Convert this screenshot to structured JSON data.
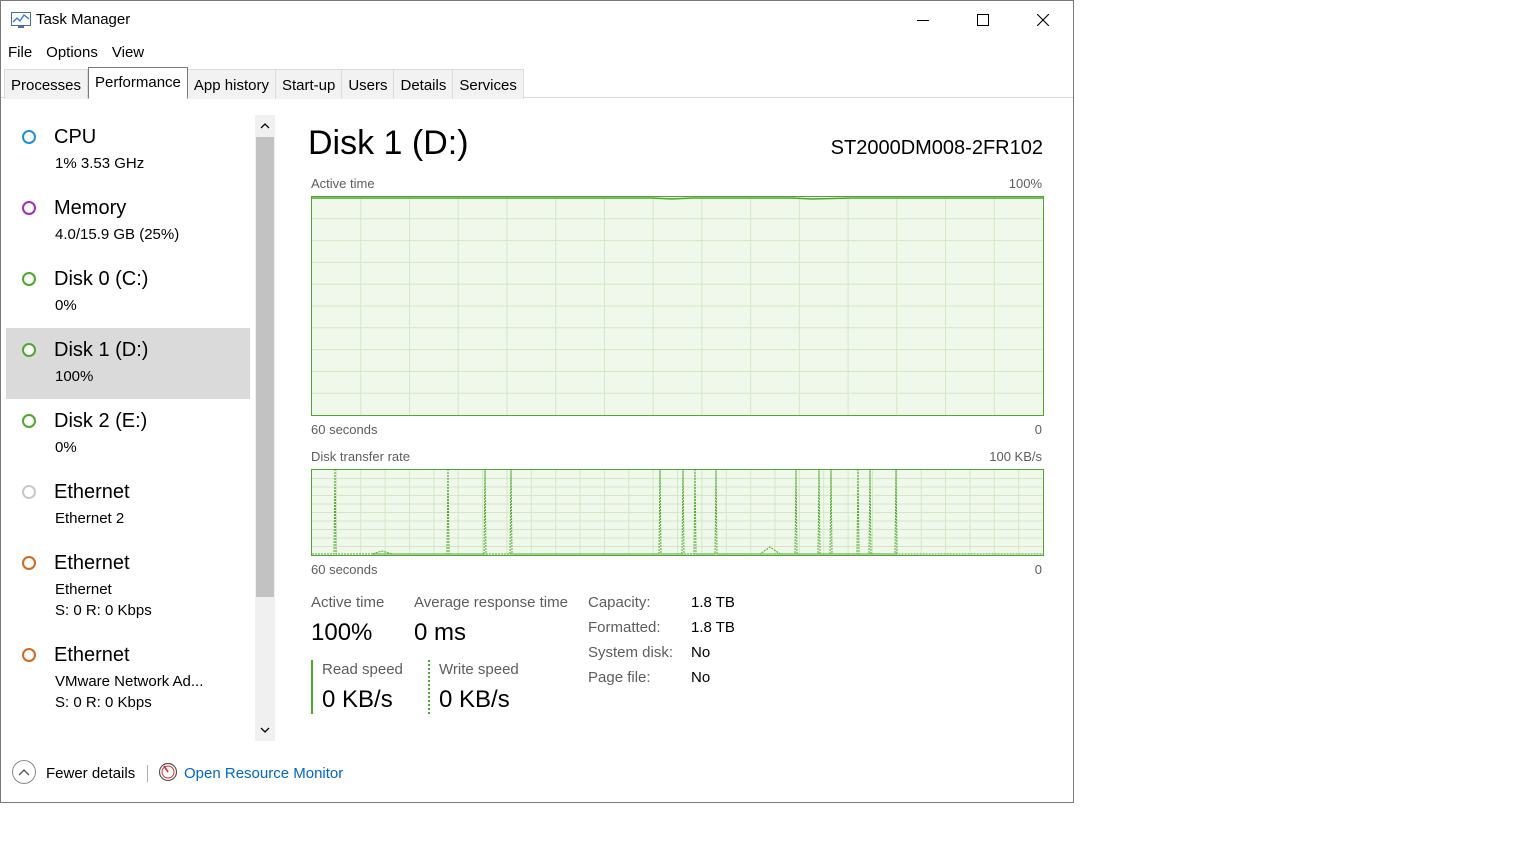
{
  "window": {
    "title": "Task Manager"
  },
  "menu": [
    "File",
    "Options",
    "View"
  ],
  "tabs": [
    "Processes",
    "Performance",
    "App history",
    "Start-up",
    "Users",
    "Details",
    "Services"
  ],
  "active_tab": "Performance",
  "sidebar": [
    {
      "name": "CPU",
      "sub": "1%  3.53 GHz",
      "sub2": "",
      "color": "#1e90d6"
    },
    {
      "name": "Memory",
      "sub": "4.0/15.9 GB (25%)",
      "sub2": "",
      "color": "#a22dbf"
    },
    {
      "name": "Disk 0 (C:)",
      "sub": "0%",
      "sub2": "",
      "color": "#4ea72e"
    },
    {
      "name": "Disk 1 (D:)",
      "sub": "100%",
      "sub2": "",
      "color": "#4ea72e",
      "selected": true
    },
    {
      "name": "Disk 2 (E:)",
      "sub": "0%",
      "sub2": "",
      "color": "#4ea72e"
    },
    {
      "name": "Ethernet",
      "sub": "Ethernet 2",
      "sub2": "",
      "color": "#c8c8c8"
    },
    {
      "name": "Ethernet",
      "sub": "Ethernet",
      "sub2": "S: 0  R: 0 Kbps",
      "color": "#d2691e"
    },
    {
      "name": "Ethernet",
      "sub": "VMware Network Ad...",
      "sub2": "S: 0  R: 0 Kbps",
      "color": "#d2691e"
    }
  ],
  "detail": {
    "title": "Disk 1 (D:)",
    "model": "ST2000DM008-2FR102",
    "graph1": {
      "label": "Active time",
      "max_label": "100%",
      "time_label": "60 seconds",
      "zero_label": "0"
    },
    "graph2": {
      "label": "Disk transfer rate",
      "max_label": "100 KB/s",
      "time_label": "60 seconds",
      "zero_label": "0"
    },
    "active_time": {
      "label": "Active time",
      "value": "100%"
    },
    "avg_response": {
      "label": "Average response time",
      "value": "0 ms"
    },
    "read_speed": {
      "label": "Read speed",
      "value": "0 KB/s"
    },
    "write_speed": {
      "label": "Write speed",
      "value": "0 KB/s"
    },
    "info": [
      {
        "label": "Capacity:",
        "value": "1.8 TB"
      },
      {
        "label": "Formatted:",
        "value": "1.8 TB"
      },
      {
        "label": "System disk:",
        "value": "No"
      },
      {
        "label": "Page file:",
        "value": "No"
      }
    ]
  },
  "footer": {
    "fewer_details": "Fewer details",
    "resource_monitor": "Open Resource Monitor"
  },
  "colors": {
    "disk_green": "#4ea72e",
    "graph_fill": "#f0f8ec",
    "link_blue": "#0066cc",
    "selected_bg": "#dadada"
  }
}
